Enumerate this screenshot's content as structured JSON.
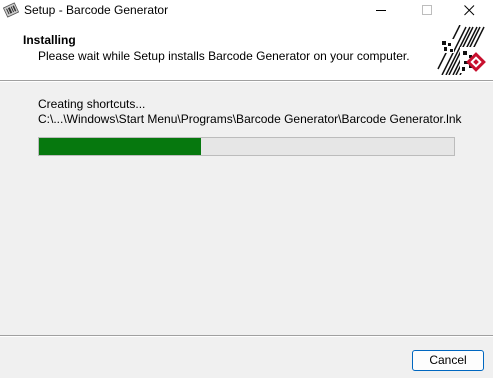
{
  "window": {
    "title": "Setup - Barcode Generator"
  },
  "header": {
    "title": "Installing",
    "subtitle": "Please wait while Setup installs Barcode Generator on your computer."
  },
  "status": {
    "text": "Creating shortcuts...",
    "detail": "C:\\...\\Windows\\Start Menu\\Programs\\Barcode Generator\\Barcode Generator.lnk"
  },
  "progress": {
    "percent": 39,
    "fill_color": "#06780e"
  },
  "footer": {
    "cancel_label": "Cancel"
  },
  "icons": {
    "app": "barcode-app-icon",
    "logo": "barcode-qr-logo"
  }
}
